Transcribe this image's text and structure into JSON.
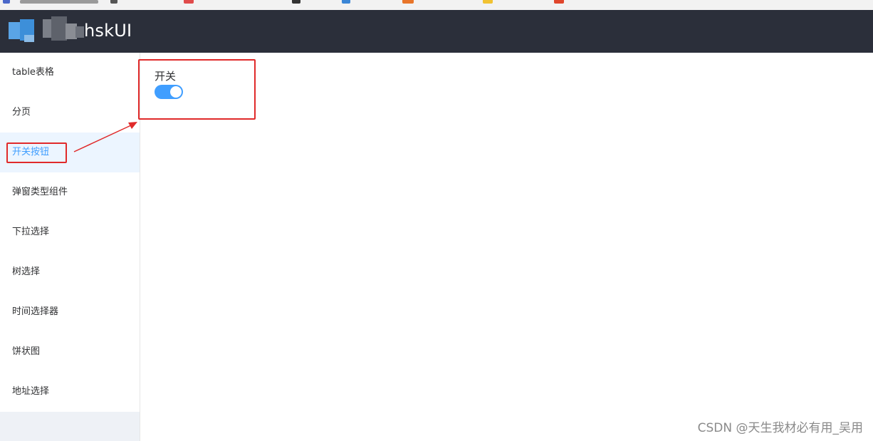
{
  "header": {
    "brand": "hskUI"
  },
  "sidebar": {
    "items": [
      {
        "label": "table表格"
      },
      {
        "label": "分页"
      },
      {
        "label": "开关按钮",
        "active": true
      },
      {
        "label": "弹窗类型组件"
      },
      {
        "label": "下拉选择"
      },
      {
        "label": "树选择"
      },
      {
        "label": "时间选择器"
      },
      {
        "label": "饼状图"
      },
      {
        "label": "地址选择"
      }
    ]
  },
  "main": {
    "switch_label": "开关",
    "switch_on": true
  },
  "watermark": "CSDN @天生我材必有用_吴用",
  "colors": {
    "header_bg": "#2b2f3a",
    "accent": "#409eff",
    "active_bg": "#ecf5ff",
    "annotation": "#e02a2a"
  }
}
